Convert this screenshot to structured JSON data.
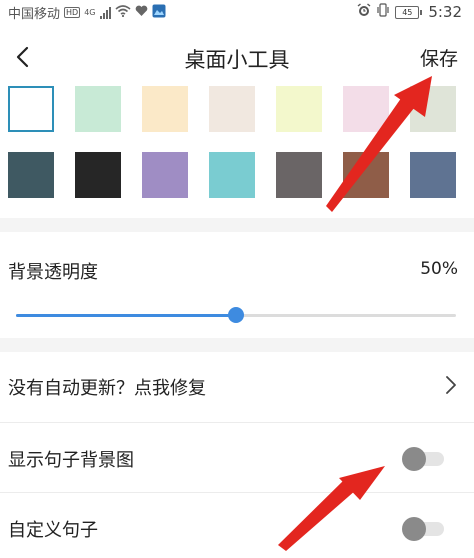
{
  "status_bar": {
    "carrier": "中国移动",
    "hd": "HD",
    "network": "4G",
    "battery": "45",
    "time": "5:32"
  },
  "header": {
    "back_icon": "chevron-left-icon",
    "title": "桌面小工具",
    "save_label": "保存"
  },
  "swatch_colors": [
    [
      "#ffffff",
      "#c8ead6",
      "#fbe9c8",
      "#f1e8e0",
      "#f3f8cc",
      "#f3dde8",
      "#dfe4d8"
    ],
    [
      "#3f5962",
      "#262626",
      "#9f8dc4",
      "#7accd1",
      "#6a6566",
      "#8f5d48",
      "#5f7392"
    ]
  ],
  "selected_swatch": "0-0",
  "transparency": {
    "label": "背景透明度",
    "value_text": "50%",
    "value": 0.5,
    "accent": "#3e8be0"
  },
  "settings": [
    {
      "label": "没有自动更新？点我修复",
      "control": "chevron"
    },
    {
      "label": "显示句子背景图",
      "control": "toggle",
      "on": false
    },
    {
      "label": "自定义句子",
      "control": "toggle",
      "on": false
    }
  ],
  "annotation_color": "#e3261f"
}
